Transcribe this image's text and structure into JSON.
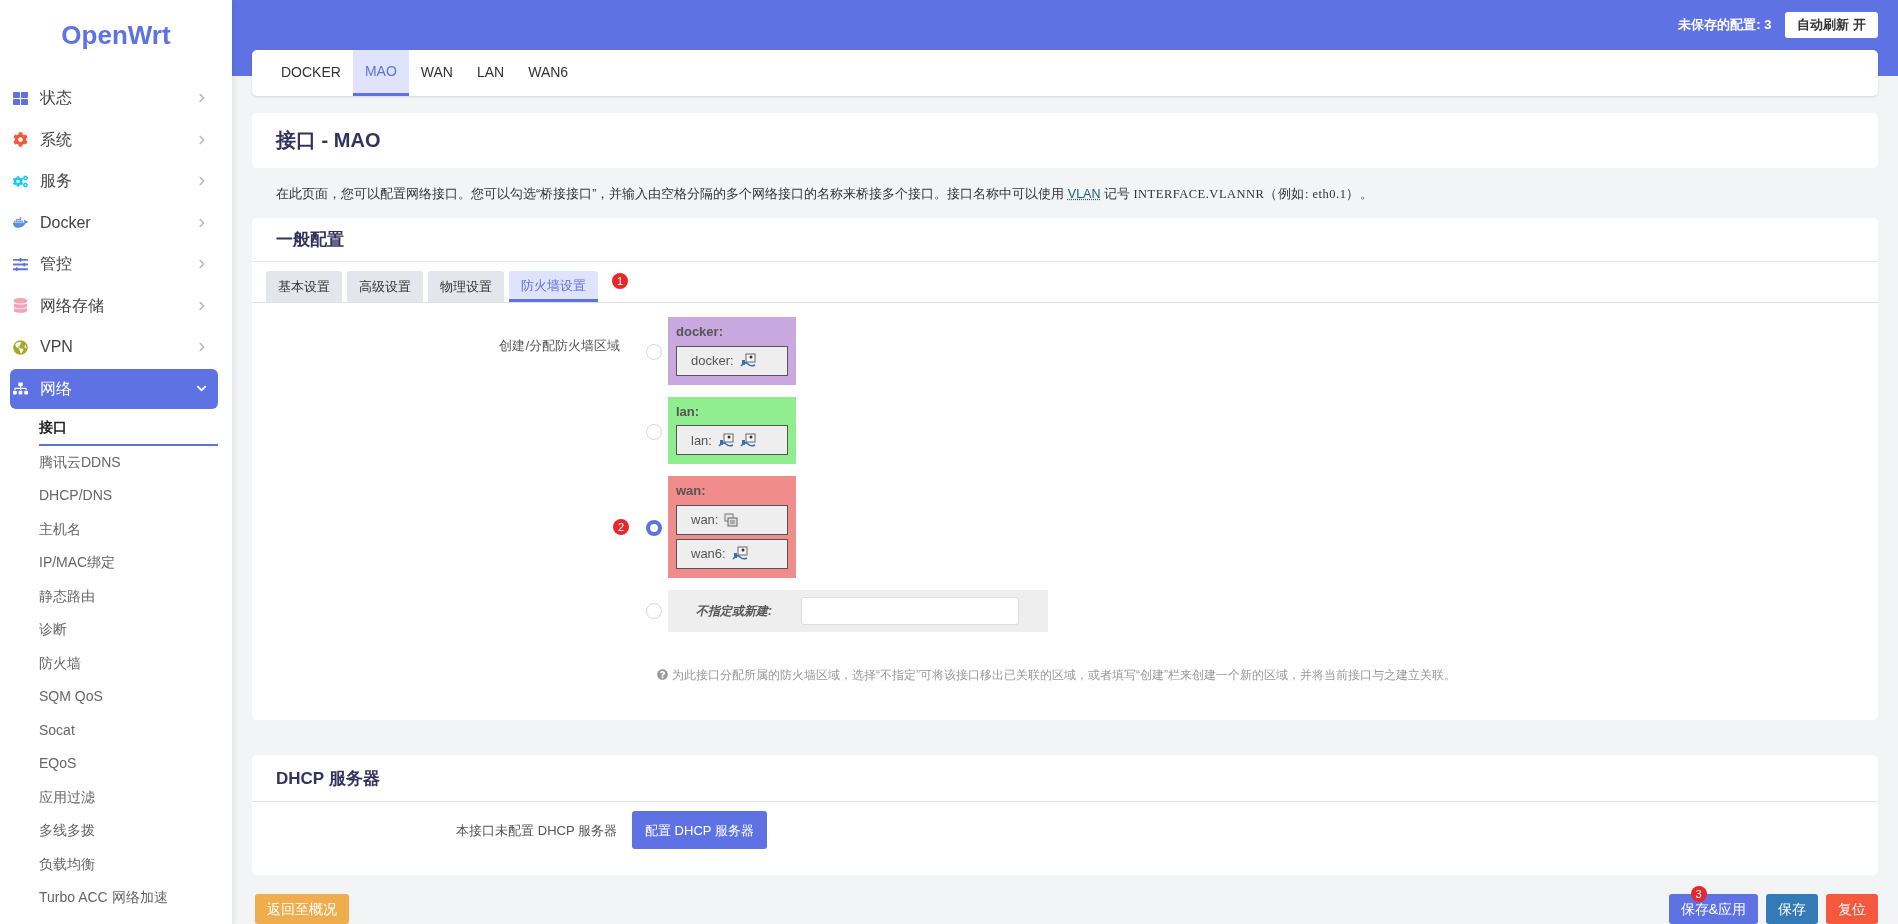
{
  "sidebar": {
    "logo": "OpenWrt",
    "items": [
      {
        "label": "状态",
        "expanded": false
      },
      {
        "label": "系统",
        "expanded": false
      },
      {
        "label": "服务",
        "expanded": false
      },
      {
        "label": "Docker",
        "expanded": false
      },
      {
        "label": "管控",
        "expanded": false
      },
      {
        "label": "网络存储",
        "expanded": false
      },
      {
        "label": "VPN",
        "expanded": false
      },
      {
        "label": "网络",
        "expanded": true,
        "children": [
          {
            "label": "接口",
            "selected": true
          },
          {
            "label": "腾讯云DDNS",
            "selected": false
          },
          {
            "label": "DHCP/DNS",
            "selected": false
          },
          {
            "label": "主机名",
            "selected": false
          },
          {
            "label": "IP/MAC绑定",
            "selected": false
          },
          {
            "label": "静态路由",
            "selected": false
          },
          {
            "label": "诊断",
            "selected": false
          },
          {
            "label": "防火墙",
            "selected": false
          },
          {
            "label": "SQM QoS",
            "selected": false
          },
          {
            "label": "Socat",
            "selected": false
          },
          {
            "label": "EQoS",
            "selected": false
          },
          {
            "label": "应用过滤",
            "selected": false
          },
          {
            "label": "多线多拨",
            "selected": false
          },
          {
            "label": "负载均衡",
            "selected": false
          },
          {
            "label": "Turbo ACC 网络加速",
            "selected": false
          }
        ]
      }
    ]
  },
  "header": {
    "unsaved": "未保存的配置: 3",
    "auto_refresh": "自动刷新 开"
  },
  "interface_tabs": [
    {
      "label": "DOCKER",
      "selected": false
    },
    {
      "label": "MAO",
      "selected": true
    },
    {
      "label": "WAN",
      "selected": false
    },
    {
      "label": "LAN",
      "selected": false
    },
    {
      "label": "WAN6",
      "selected": false
    }
  ],
  "page_title": "接口 - MAO",
  "description": [
    {
      "kind": "text",
      "text": "在此页面，您可以配置网络接口。您可以勾选“桥接接口”，并输入由空格分隔的多个网络接口的名称来桥接多个接口。接口名称中可以使用 "
    },
    {
      "kind": "link",
      "text": "VLAN"
    },
    {
      "kind": "text",
      "text": " 记号 "
    },
    {
      "kind": "code",
      "text": "INTERFACE.VLANNR（例如: eth0.1）。"
    }
  ],
  "general": {
    "title": "一般配置",
    "tabs": [
      {
        "label": "基本设置",
        "selected": false
      },
      {
        "label": "高级设置",
        "selected": false
      },
      {
        "label": "物理设置",
        "selected": false
      },
      {
        "label": "防火墙设置",
        "selected": true,
        "marker": "1"
      }
    ],
    "firewall_label": "创建/分配防火墙区域",
    "zones": [
      {
        "name": "docker:",
        "color": "#c9a8e0",
        "selected": false,
        "interfaces": [
          {
            "label": "docker:",
            "devices": [
              {
                "kind": "port"
              }
            ]
          }
        ]
      },
      {
        "name": "lan:",
        "color": "#90ee90",
        "selected": false,
        "interfaces": [
          {
            "label": "lan:",
            "devices": [
              {
                "kind": "port"
              },
              {
                "kind": "port"
              }
            ]
          }
        ]
      },
      {
        "name": "wan:",
        "color": "#f08c8c",
        "selected": true,
        "marker": "2",
        "interfaces": [
          {
            "label": "wan:",
            "devices": [
              {
                "kind": "alias"
              }
            ]
          },
          {
            "label": "wan6:",
            "devices": [
              {
                "kind": "port"
              }
            ]
          }
        ]
      }
    ],
    "new_zone": {
      "label": "不指定或新建:",
      "selected": false
    },
    "help": "为此接口分配所属的防火墙区域，选择“不指定”可将该接口移出已关联的区域，或者填写“创建”栏来创建一个新的区域，并将当前接口与之建立关联。"
  },
  "dhcp": {
    "title": "DHCP 服务器",
    "note": "本接口未配置 DHCP 服务器",
    "button": "配置 DHCP 服务器"
  },
  "footer": {
    "left": [
      {
        "label": "返回至概况",
        "kind": "back"
      }
    ],
    "right": [
      {
        "label": "保存&应用",
        "kind": "apply",
        "marker": "3"
      },
      {
        "label": "保存",
        "kind": "save"
      },
      {
        "label": "复位",
        "kind": "reset"
      }
    ]
  }
}
